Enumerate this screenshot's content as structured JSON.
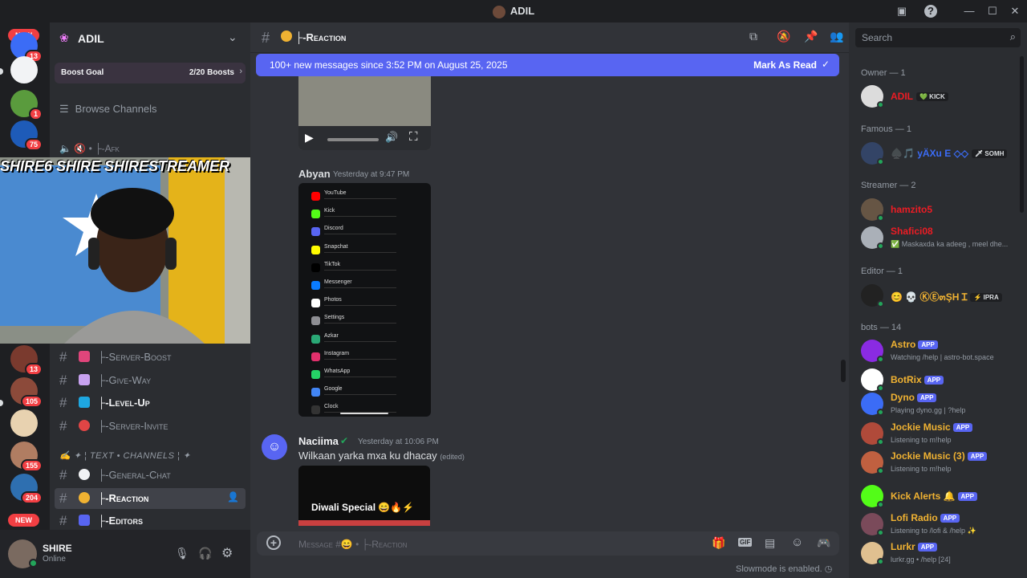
{
  "window": {
    "title": "ADIL"
  },
  "guilds": {
    "items": [
      {
        "badge": "13"
      },
      {
        "badge": ""
      },
      {
        "badge": "1"
      },
      {
        "badge": "75"
      },
      {
        "badge": "13"
      },
      {
        "badge": "105"
      },
      {
        "badge": ""
      },
      {
        "badge": "155"
      },
      {
        "badge": "204"
      }
    ],
    "new_label": "NEW"
  },
  "server": {
    "name": "ADIL",
    "boost_label": "Boost Goal",
    "boost_count": "2/20 Boosts",
    "browse": "Browse Channels",
    "voice_channel": "Afk",
    "category": "✍ ✦ ¦ TEXT • CHANNELS ¦ ✦",
    "channels": [
      {
        "name": "├-Server-Boost"
      },
      {
        "name": "├-Give-Way"
      },
      {
        "name": "├-Level-Up"
      },
      {
        "name": "├-Server-Invite"
      },
      {
        "name": "├-General-Chat"
      },
      {
        "name": "├-Reaction"
      },
      {
        "name": "├-Editors"
      }
    ]
  },
  "stream_overlay": {
    "text": "SHIRE6  SHIRE  SHIRESTREAMER"
  },
  "user": {
    "name": "SHIRE",
    "status": "Online"
  },
  "chat": {
    "channel_title": "├-Reaction",
    "new_messages": "100+ new messages since 3:52 PM on August 25, 2025",
    "mark_read": "Mark As Read",
    "messages": [
      {
        "author": "Abyan",
        "time": "Yesterday at 9:47 PM"
      },
      {
        "author": "Naciima",
        "time": "Yesterday at 10:06 PM",
        "text": "Wilkaan yarka mxa ku dhacay",
        "edited": "(edited)",
        "embed": "Diwali Special 😄🔥⚡"
      }
    ],
    "phone_apps": [
      "YouTube",
      "Kick",
      "Discord",
      "Snapchat",
      "TikTok",
      "Messenger",
      "Photos",
      "Settings",
      "Azkar",
      "Instagram",
      "WhatsApp",
      "Google",
      "Clock"
    ],
    "composer_placeholder": "Message #😄 • ├-Reaction",
    "slowmode": "Slowmode is enabled."
  },
  "members": {
    "search_placeholder": "Search",
    "groups": [
      {
        "label": "Owner — 1"
      },
      {
        "label": "Famous — 1"
      },
      {
        "label": "Streamer — 2"
      },
      {
        "label": "Editor — 1"
      },
      {
        "label": "bots — 14"
      }
    ],
    "list": [
      {
        "name": "ADIL",
        "tag": "💚 KICK",
        "status": "",
        "color": "#ed1c24"
      },
      {
        "name": "♠️🎵 yÄXu E ◇◇",
        "tag": "🗡 SOMH",
        "status": "",
        "color": "#3b6cf6"
      },
      {
        "name": "hamzito5",
        "tag": "",
        "status": "",
        "color": "#ed1c24"
      },
      {
        "name": "Shafici08",
        "tag": "",
        "status": "✅ Maskaxda ka adeeg , meel dhe...",
        "color": "#ed1c24"
      },
      {
        "name": "😊 💀 ⓀⒺ๓ŞH Ɪ",
        "tag": "⚡ IPRA",
        "status": "",
        "color": "#f0b232"
      },
      {
        "name": "Astro",
        "tag": "APP",
        "status": "Watching /help | astro-bot.space",
        "color": "#f0b232"
      },
      {
        "name": "BotRix",
        "tag": "APP",
        "status": "",
        "color": "#f0b232"
      },
      {
        "name": "Dyno",
        "tag": "APP",
        "status": "Playing dyno.gg | ?help",
        "color": "#f0b232"
      },
      {
        "name": "Jockie Music",
        "tag": "APP",
        "status": "Listening to m!help",
        "color": "#f0b232"
      },
      {
        "name": "Jockie Music (3)",
        "tag": "APP",
        "status": "Listening to m!help",
        "color": "#f0b232"
      },
      {
        "name": "Kick Alerts 🔔",
        "tag": "APP",
        "status": "",
        "color": "#f0b232"
      },
      {
        "name": "Lofi Radio",
        "tag": "APP",
        "status": "Listening to /lofi & /help ✨",
        "color": "#f0b232"
      },
      {
        "name": "Lurkr",
        "tag": "APP",
        "status": "lurkr.gg • /help [24]",
        "color": "#f0b232"
      }
    ]
  }
}
